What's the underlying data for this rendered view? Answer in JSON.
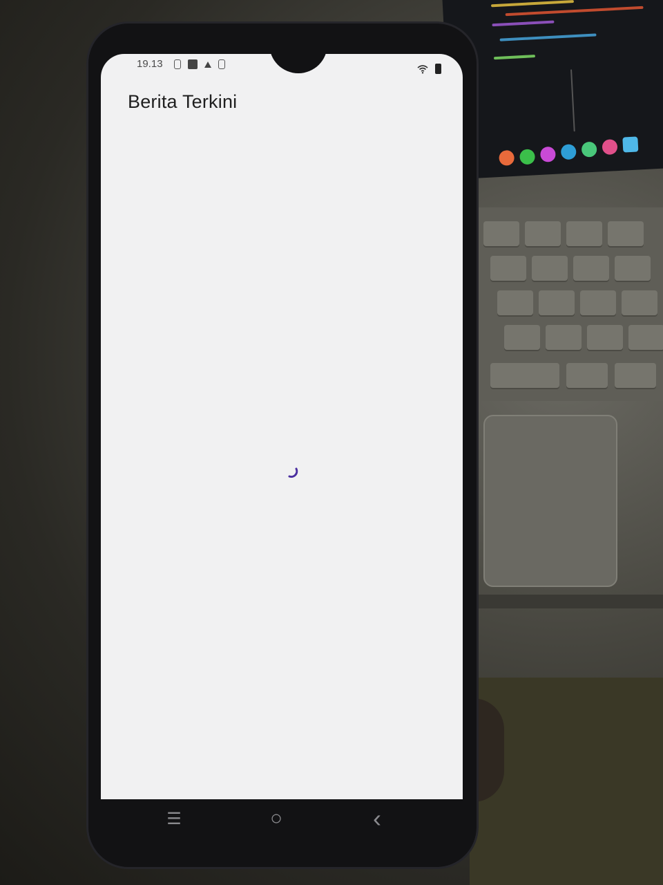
{
  "status_bar": {
    "time": "19.13",
    "left_icons": [
      "sim-icon",
      "notification-icon",
      "warning-icon",
      "sim-icon"
    ],
    "right_icons": [
      "wifi-icon",
      "battery-icon"
    ]
  },
  "app": {
    "title": "Berita Terkini",
    "state": "loading",
    "accent_color": "#4b2fa0"
  },
  "navigation_bar": {
    "buttons": [
      "recent-apps-icon",
      "home-icon",
      "back-icon"
    ],
    "recent_symbol": "☰",
    "home_symbol": "○",
    "back_symbol": "‹"
  }
}
